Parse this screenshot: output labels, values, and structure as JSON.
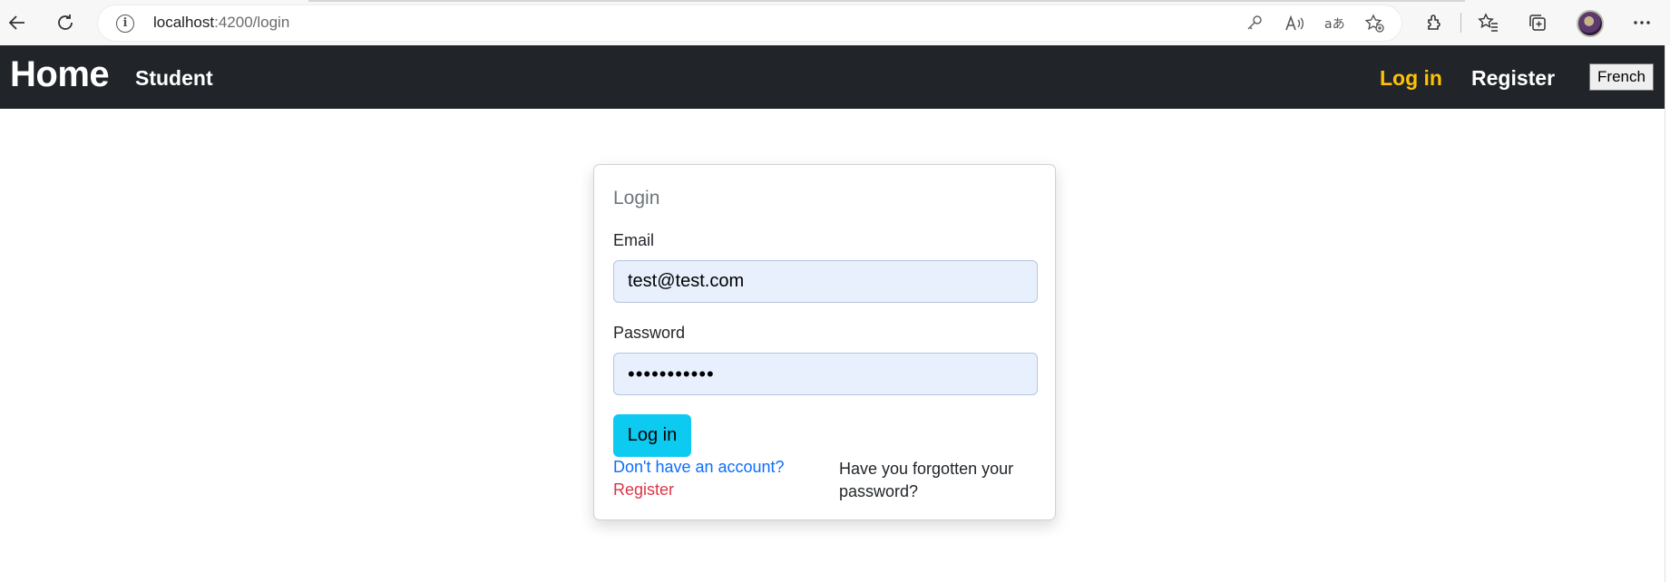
{
  "browser": {
    "url_host": "localhost",
    "url_path": ":4200/login",
    "icons": [
      "back-icon",
      "refresh-icon",
      "info-icon",
      "key-icon",
      "read-aloud-icon",
      "translate-icon",
      "add-favorite-icon",
      "extensions-icon",
      "favorites-icon",
      "collections-icon",
      "profile-avatar",
      "more-icon"
    ]
  },
  "navbar": {
    "brand": "Home",
    "student": "Student",
    "login": "Log in",
    "register": "Register",
    "language": "French"
  },
  "login_card": {
    "title": "Login",
    "email_label": "Email",
    "email_value": "test@test.com",
    "password_label": "Password",
    "password_value": "•••••••••••",
    "submit_label": "Log in",
    "no_account_text": "Don't have an account?",
    "register_link": "Register",
    "forgot_text": "Have you forgotten your password?"
  },
  "colors": {
    "navbar_bg": "#212529",
    "login_active": "#ffc107",
    "submit_bg": "#0dcaf0",
    "link_blue": "#0d6efd",
    "link_red": "#dc3545",
    "input_bg": "#e8f0fe"
  }
}
